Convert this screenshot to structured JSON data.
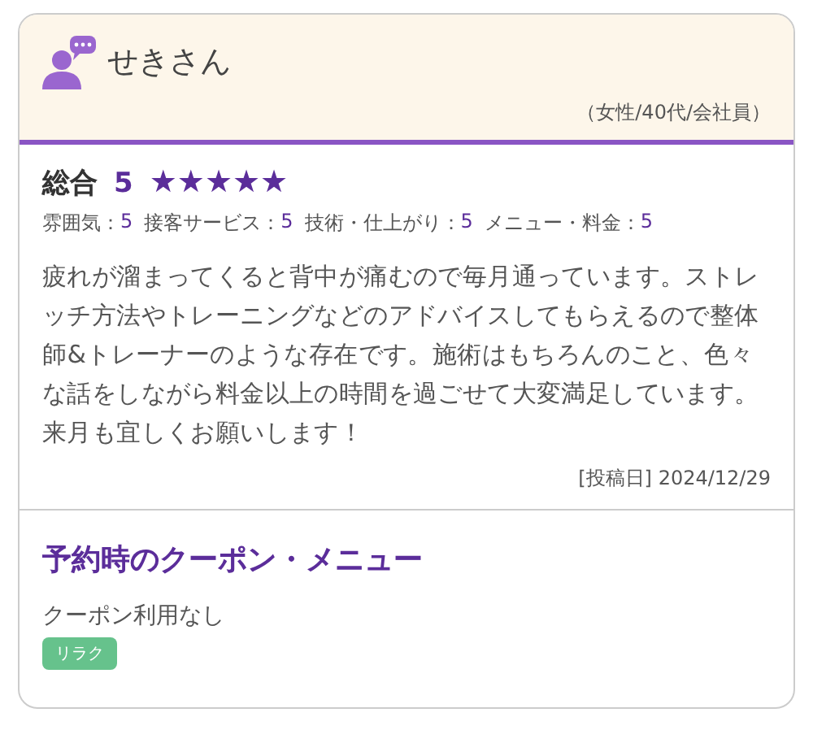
{
  "reviewer": {
    "name": "せきさん",
    "profile": "（女性/40代/会社員）"
  },
  "overall": {
    "label": "総合",
    "score": "5",
    "stars": 5
  },
  "ratings": [
    {
      "label": "雰囲気：",
      "value": "5"
    },
    {
      "label": "接客サービス：",
      "value": "5"
    },
    {
      "label": "技術・仕上がり：",
      "value": "5"
    },
    {
      "label": "メニュー・料金：",
      "value": "5"
    }
  ],
  "comment": "疲れが溜まってくると背中が痛むので毎月通っています。ストレッチ方法やトレーニングなどのアドバイスしてもらえるので整体師&トレーナーのような存在です。施術はもちろんのこと、色々な話をしながら料金以上の時間を過ごせて大変満足しています。来月も宜しくお願いします！",
  "posted": {
    "label": "[投稿日]",
    "date": "2024/12/29"
  },
  "coupon": {
    "title": "予約時のクーポン・メニュー",
    "text": "クーポン利用なし",
    "tags": [
      {
        "label": "リラク",
        "color": "#66c28c"
      }
    ]
  }
}
